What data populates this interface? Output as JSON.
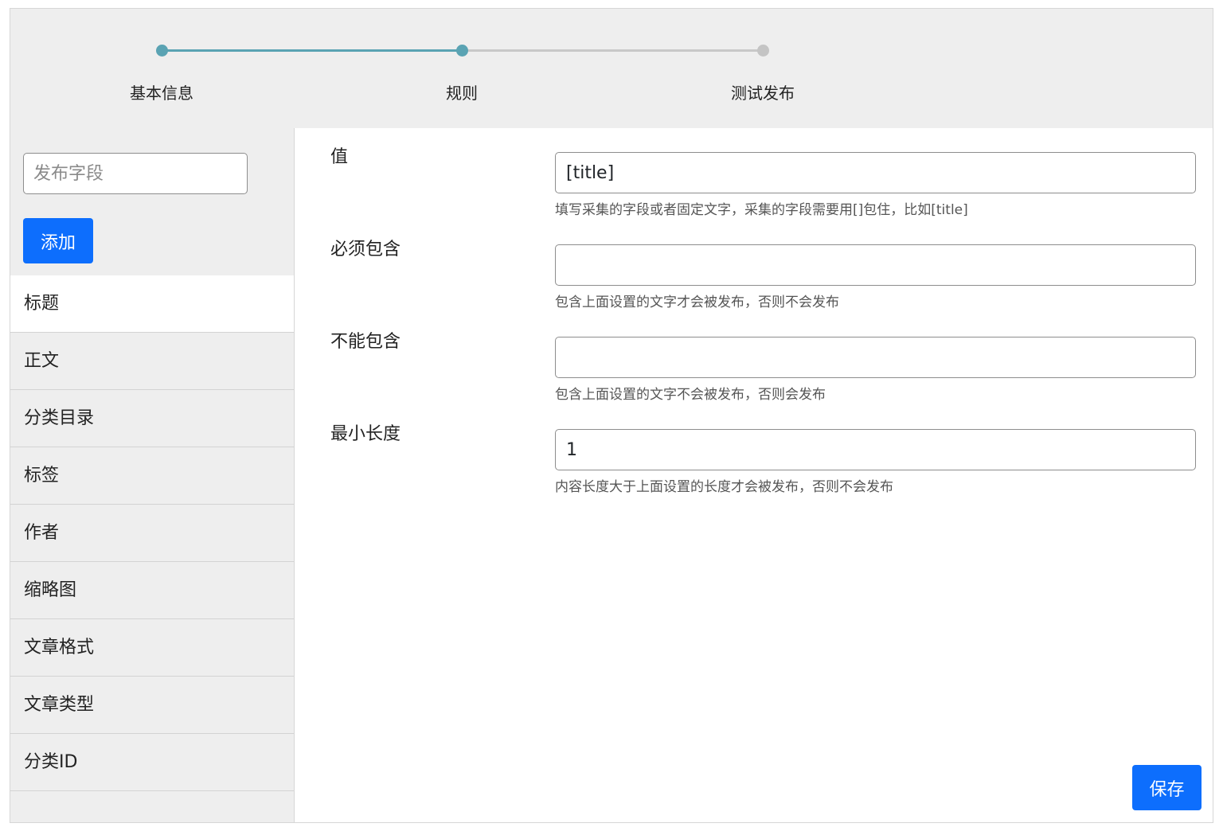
{
  "stepper": {
    "steps": [
      {
        "label": "基本信息",
        "state": "done"
      },
      {
        "label": "规则",
        "state": "current"
      },
      {
        "label": "测试发布",
        "state": "pending"
      }
    ],
    "active_color": "#5aa3b3",
    "inactive_color": "#c4c4c4"
  },
  "sidebar": {
    "field_input": {
      "placeholder": "发布字段",
      "value": ""
    },
    "add_label": "添加",
    "items": [
      {
        "label": "标题",
        "active": true
      },
      {
        "label": "正文",
        "active": false
      },
      {
        "label": "分类目录",
        "active": false
      },
      {
        "label": "标签",
        "active": false
      },
      {
        "label": "作者",
        "active": false
      },
      {
        "label": "缩略图",
        "active": false
      },
      {
        "label": "文章格式",
        "active": false
      },
      {
        "label": "文章类型",
        "active": false
      },
      {
        "label": "分类ID",
        "active": false
      }
    ]
  },
  "form": {
    "value": {
      "label": "值",
      "input": "[title]",
      "help": "填写采集的字段或者固定文字，采集的字段需要用[]包住，比如[title]"
    },
    "must_contain": {
      "label": "必须包含",
      "input": "",
      "help": "包含上面设置的文字才会被发布，否则不会发布"
    },
    "must_not_contain": {
      "label": "不能包含",
      "input": "",
      "help": "包含上面设置的文字不会被发布，否则会发布"
    },
    "min_length": {
      "label": "最小长度",
      "input": "1",
      "help": "内容长度大于上面设置的长度才会被发布，否则不会发布"
    },
    "save_label": "保存"
  },
  "colors": {
    "primary": "#0d6efd",
    "panel_bg": "#eeeeee"
  }
}
